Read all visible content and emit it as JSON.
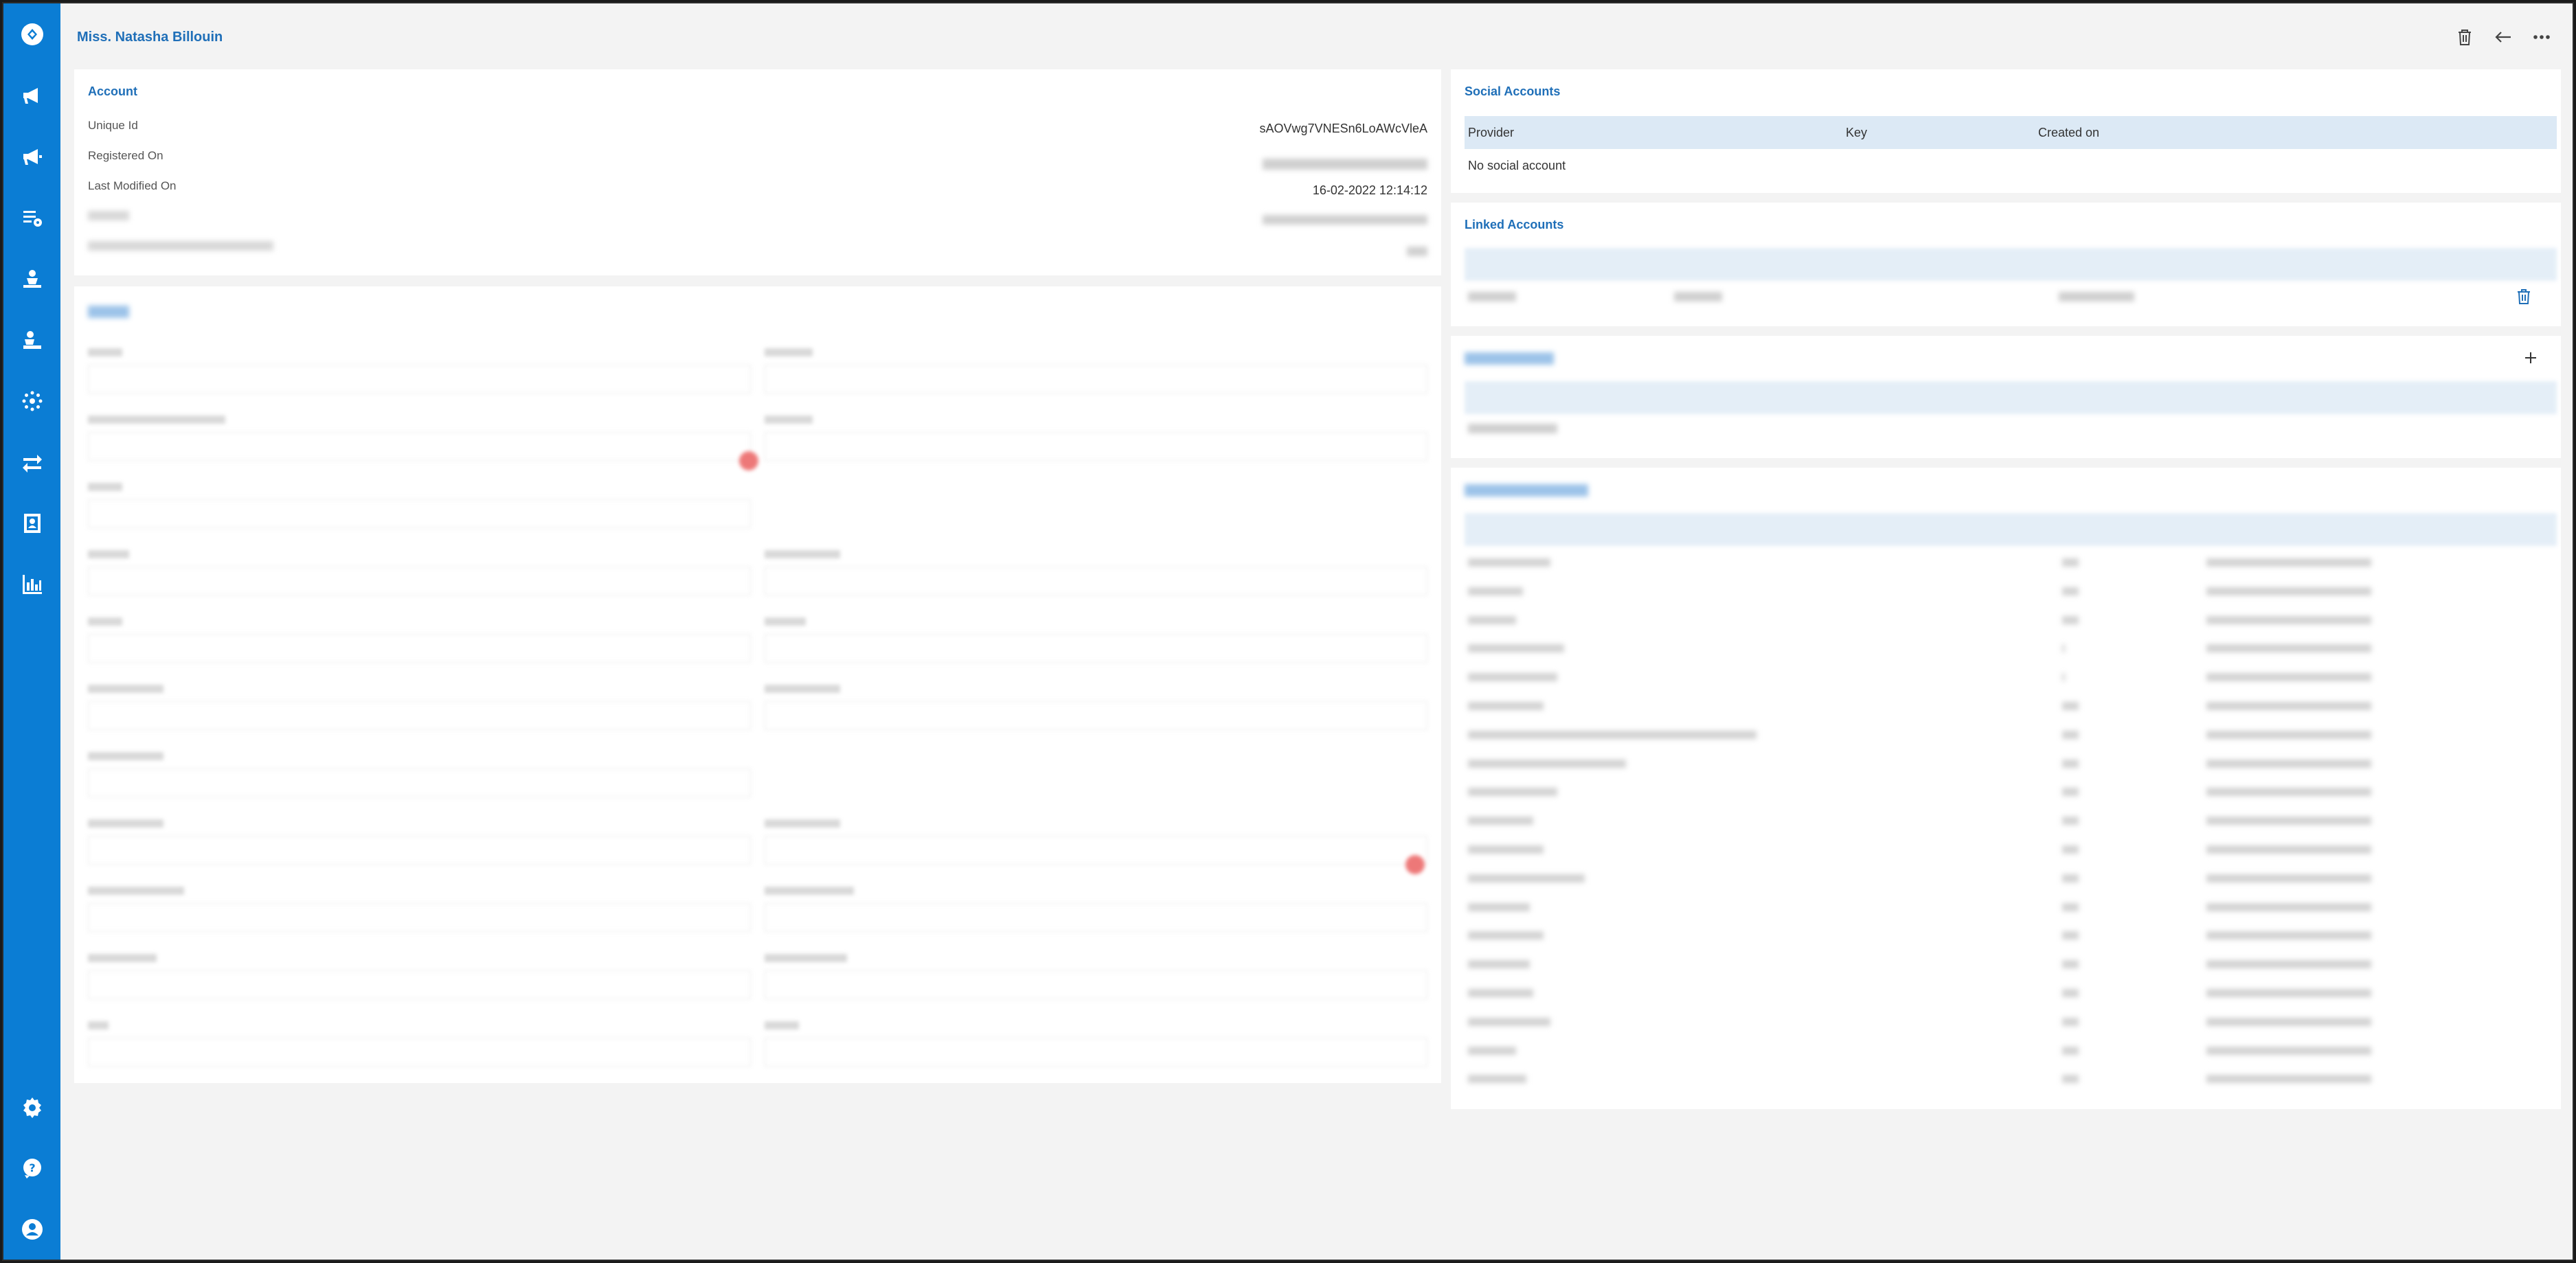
{
  "header": {
    "title": "Miss. Natasha Billouin"
  },
  "sidebar": {
    "top_icons": [
      "logo-icon",
      "campaign-icon",
      "campaign-alt-icon",
      "list-settings-icon",
      "user-hands-icon",
      "user-hands-alt-icon",
      "network-icon",
      "transfer-icon",
      "contact-icon",
      "chart-icon"
    ],
    "bottom_icons": [
      "settings-icon",
      "help-icon",
      "account-icon"
    ]
  },
  "account": {
    "title": "Account",
    "rows": [
      {
        "label": "Unique Id",
        "value": "sAOVwg7VNESn6LoAWcVleA"
      },
      {
        "label": "Registered On",
        "value": ""
      },
      {
        "label": "Last Modified On",
        "value": "16-02-2022 12:14:12"
      }
    ]
  },
  "social": {
    "title": "Social Accounts",
    "columns": [
      "Provider",
      "Key",
      "Created on"
    ],
    "empty": "No social account"
  },
  "linked": {
    "title": "Linked Accounts"
  },
  "colors": {
    "sidebar": "#0b7dd4",
    "accent": "#1f6fb8",
    "table_header": "#dce9f5"
  }
}
